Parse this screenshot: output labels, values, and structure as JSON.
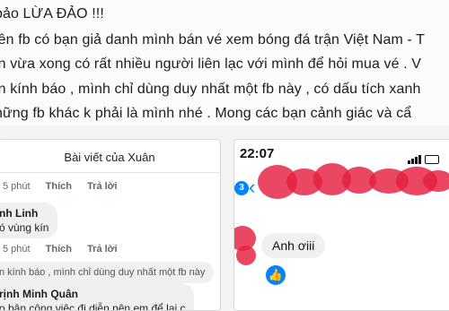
{
  "post": {
    "lines": [
      "bảo LỪA ĐẢO !!!",
      "iên fb có bạn giả danh mình bán vé xem bóng đá trận Việt Nam - T",
      "in vừa xong có rất nhiều người liên lạc với mình để hỏi mua vé . V",
      "in kính báo , mình chỉ dùng duy nhất một fb này , có dấu tích xanh",
      "hững fb khác k phải là mình nhé . Mong các bạn cảnh giác và cẩ"
    ]
  },
  "comments_panel": {
    "header": "Bài viết của Xuân",
    "action_row_1": {
      "time": "5 phút",
      "like": "Thích",
      "reply": "Trả lời"
    },
    "comment_1": {
      "name": "nh Linh",
      "text": "ó vùng kín"
    },
    "action_row_2": {
      "time": "5 phút",
      "like": "Thích",
      "reply": "Trả lời"
    },
    "comment_2": {
      "text": "n kính báo , mình chỉ dùng duy nhất một fb này"
    },
    "comment_3": {
      "name": "rịnh Minh Quân",
      "text": "o bận công việc đi diễn nên em để lại c"
    }
  },
  "messenger": {
    "time": "22:07",
    "unread_count": "3",
    "back_symbol": "‹",
    "message": "Anh ơiii",
    "like_symbol": "👍",
    "accent": "#0084ff",
    "redaction_color": "#e41f3f"
  }
}
